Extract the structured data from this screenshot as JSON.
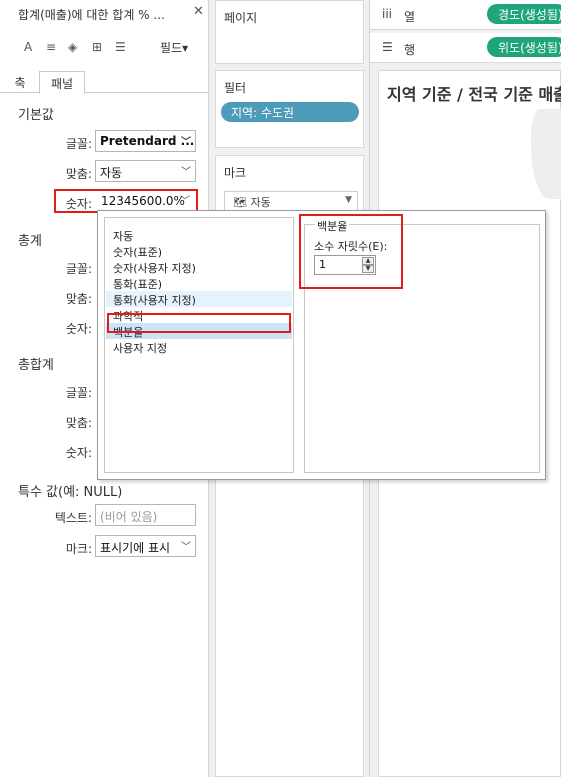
{
  "left_pane": {
    "title": "합계(매출)에 대한 합계 % ...",
    "close_glyph": "✕",
    "toolbar_icons": [
      {
        "icon": "font-icon",
        "glyph": "A"
      },
      {
        "icon": "alignment-icon",
        "glyph": "≡"
      },
      {
        "icon": "shading-icon",
        "glyph": "◈"
      },
      {
        "icon": "borders-icon",
        "glyph": "⊞"
      },
      {
        "icon": "lines-icon",
        "glyph": "☰"
      }
    ],
    "fields_label": "필드",
    "fields_chevron": "▾",
    "tabs": {
      "axis": "축",
      "pane": "패널"
    },
    "default_section": {
      "heading": "기본값",
      "font_label": "글꼴:",
      "font_value": "Pretendard ...",
      "align_label": "맞춤:",
      "align_value": "자동",
      "numbers_label": "숫자:",
      "numbers_value": "12345600.0%"
    },
    "totals_section": {
      "heading": "총계",
      "font_label": "글꼴:",
      "align_label": "맞춤:",
      "numbers_label": "숫자:"
    },
    "grand_totals_section": {
      "heading": "총합계",
      "font_label": "글꼴:",
      "align_label": "맞춤:",
      "numbers_label": "숫자:"
    },
    "special_values": {
      "heading": "특수 값(예: NULL)",
      "text_label": "텍스트:",
      "text_placeholder": "(비어 있음)",
      "marks_label": "마크:",
      "marks_value": "표시기에 표시"
    }
  },
  "shelves": {
    "pages_title": "페이지",
    "filters_title": "필터",
    "filter_pill": "지역: 수도권",
    "marks_title": "마크",
    "marks_type": "자동"
  },
  "right": {
    "columns_label": "열",
    "columns_icon": "iii",
    "columns_pill": "경도(생성됨)",
    "rows_label": "행",
    "rows_icon": "☰",
    "rows_pill": "위도(생성됨)",
    "sheet_title": "지역 기준 / 전국 기준 매출"
  },
  "number_format_dialog": {
    "options": [
      "자동",
      "숫자(표준)",
      "숫자(사용자 지정)",
      "통화(표준)",
      "통화(사용자 지정)",
      "과학적",
      "백분율",
      "사용자 지정"
    ],
    "selected": "백분율",
    "hovered": "통화(사용자 지정)",
    "group_title": "백분율",
    "decimal_label": "소수 자릿수(E):",
    "decimal_value": "1"
  },
  "colors": {
    "highlight_red": "#e31b1b",
    "filter_pill": "#4e9bb9",
    "dimension_pill_green": "#20a47b",
    "selected_row": "#cce4f7"
  }
}
